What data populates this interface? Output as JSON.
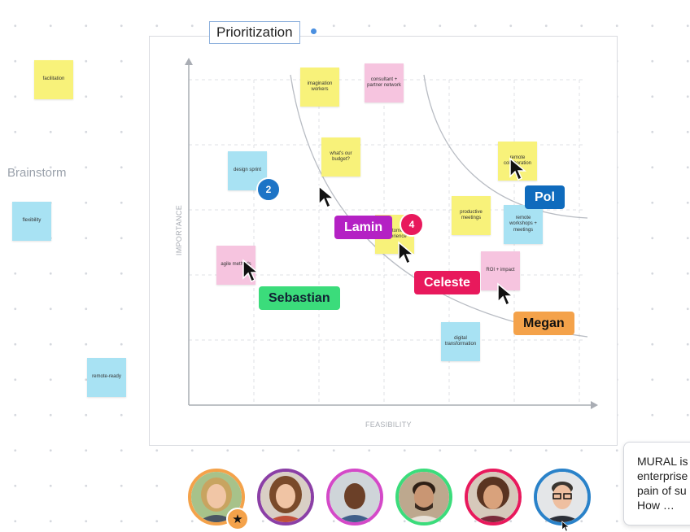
{
  "board": {
    "frame_title": "Prioritization",
    "section_label": "Brainstorm",
    "y_axis_label": "IMPORTANCE",
    "x_axis_label": "FEASIBILITY"
  },
  "outside_stickies": [
    {
      "text": "facilitation",
      "color": "#f8f27a"
    },
    {
      "text": "flexibility",
      "color": "#a8e2f3"
    },
    {
      "text": "remote-ready",
      "color": "#a8e2f3"
    }
  ],
  "stickies": [
    {
      "text": "imagination workers",
      "color": "#f8f27a"
    },
    {
      "text": "consultant + partner network",
      "color": "#f6c4df"
    },
    {
      "text": "design sprint",
      "color": "#a8e2f3"
    },
    {
      "text": "what's our budget?",
      "color": "#f8f27a"
    },
    {
      "text": "remote collaboration",
      "color": "#f8f27a"
    },
    {
      "text": "productive meetings",
      "color": "#f8f27a"
    },
    {
      "text": "remote workshops + meetings",
      "color": "#a8e2f3"
    },
    {
      "text": "customer experience",
      "color": "#f8f27a"
    },
    {
      "text": "agile methods",
      "color": "#f6c4df"
    },
    {
      "text": "ROI + impact",
      "color": "#f6c4df"
    },
    {
      "text": "digital transformation",
      "color": "#a8e2f3"
    }
  ],
  "collaborators": [
    {
      "name": "Pol",
      "color": "#0f6bbd"
    },
    {
      "name": "Lamin",
      "color": "#b421c4"
    },
    {
      "name": "Celeste",
      "color": "#e8195c"
    },
    {
      "name": "Sebastian",
      "color": "#3bdc7b"
    },
    {
      "name": "Megan",
      "color": "#f4a24a"
    }
  ],
  "badges": [
    {
      "count": "2",
      "color": "#1d74c6"
    },
    {
      "count": "4",
      "color": "#e8195c"
    }
  ],
  "avatars": [
    {
      "ring": "#f4a24a",
      "icon": "star-icon"
    },
    {
      "ring": "#8b3fa6"
    },
    {
      "ring": "#d449c8"
    },
    {
      "ring": "#3bdc7b"
    },
    {
      "ring": "#e8195c"
    },
    {
      "ring": "#2a82c9"
    }
  ],
  "tooltip": {
    "lines": [
      "MURAL is",
      "enterprise",
      "pain of su",
      "How …"
    ]
  }
}
